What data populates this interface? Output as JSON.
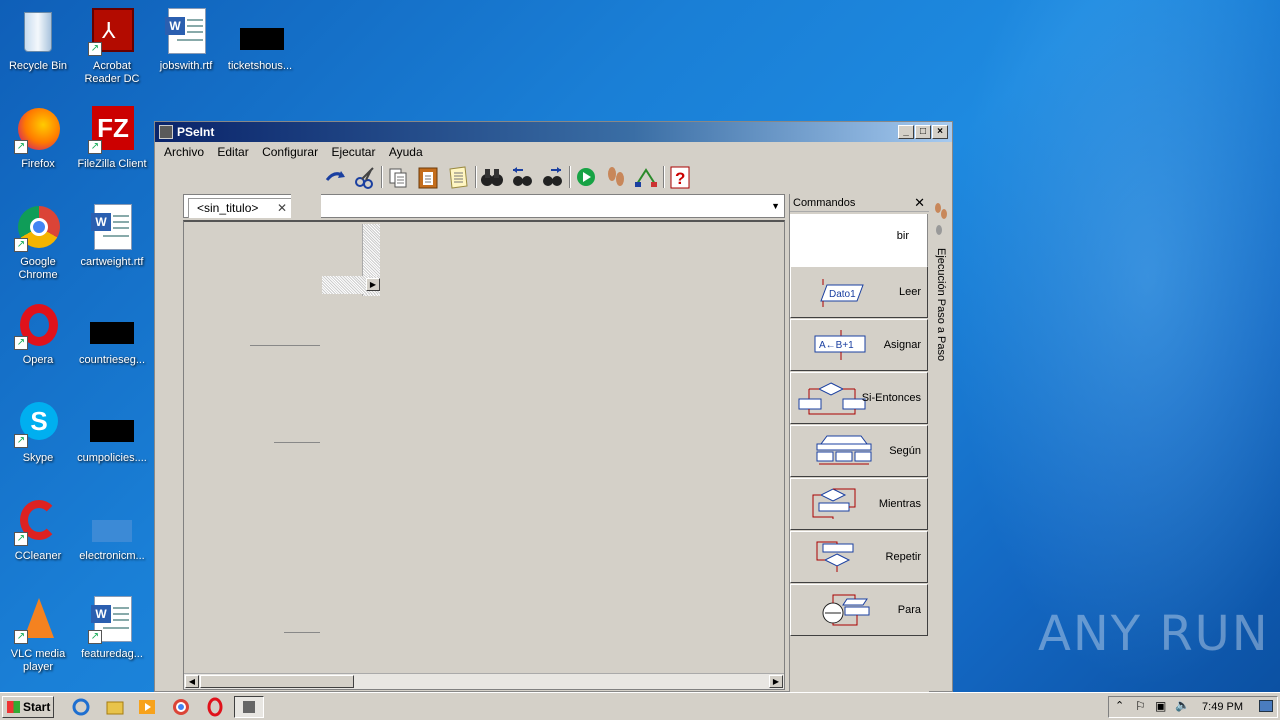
{
  "desktop": {
    "icons": [
      {
        "label": "Recycle Bin"
      },
      {
        "label": "Acrobat Reader DC"
      },
      {
        "label": "jobswith.rtf"
      },
      {
        "label": "ticketshous..."
      },
      {
        "label": "Firefox"
      },
      {
        "label": "FileZilla Client"
      },
      {
        "label": "Google Chrome"
      },
      {
        "label": "cartweight.rtf"
      },
      {
        "label": "Opera"
      },
      {
        "label": "countrieseg..."
      },
      {
        "label": "Skype"
      },
      {
        "label": "cumpolicies...."
      },
      {
        "label": "CCleaner"
      },
      {
        "label": "electronicm..."
      },
      {
        "label": "VLC media player"
      },
      {
        "label": "featuredag..."
      }
    ]
  },
  "window": {
    "title": "PSeInt",
    "menu": [
      "Archivo",
      "Editar",
      "Configurar",
      "Ejecutar",
      "Ayuda"
    ],
    "tab": {
      "label": "<sin_titulo>",
      "close": "✕"
    },
    "commands_panel": {
      "title": "Commandos",
      "close": "✕",
      "partial_label": "bir",
      "items": [
        {
          "label": "Leer",
          "icon_text": "Dato1"
        },
        {
          "label": "Asignar",
          "icon_text": "A←B+1"
        },
        {
          "label": "Si-Entonces"
        },
        {
          "label": "Según"
        },
        {
          "label": "Mientras"
        },
        {
          "label": "Repetir"
        },
        {
          "label": "Para"
        }
      ]
    },
    "side_label": "Ejecución Paso a Paso"
  },
  "taskbar": {
    "start_label": "Start",
    "clock": "7:49 PM"
  },
  "watermark": "ANY RUN",
  "colors": {
    "titlebar": "#0a246a",
    "desktop": "#1a7fd6",
    "chrome": "#d4d0c8"
  }
}
